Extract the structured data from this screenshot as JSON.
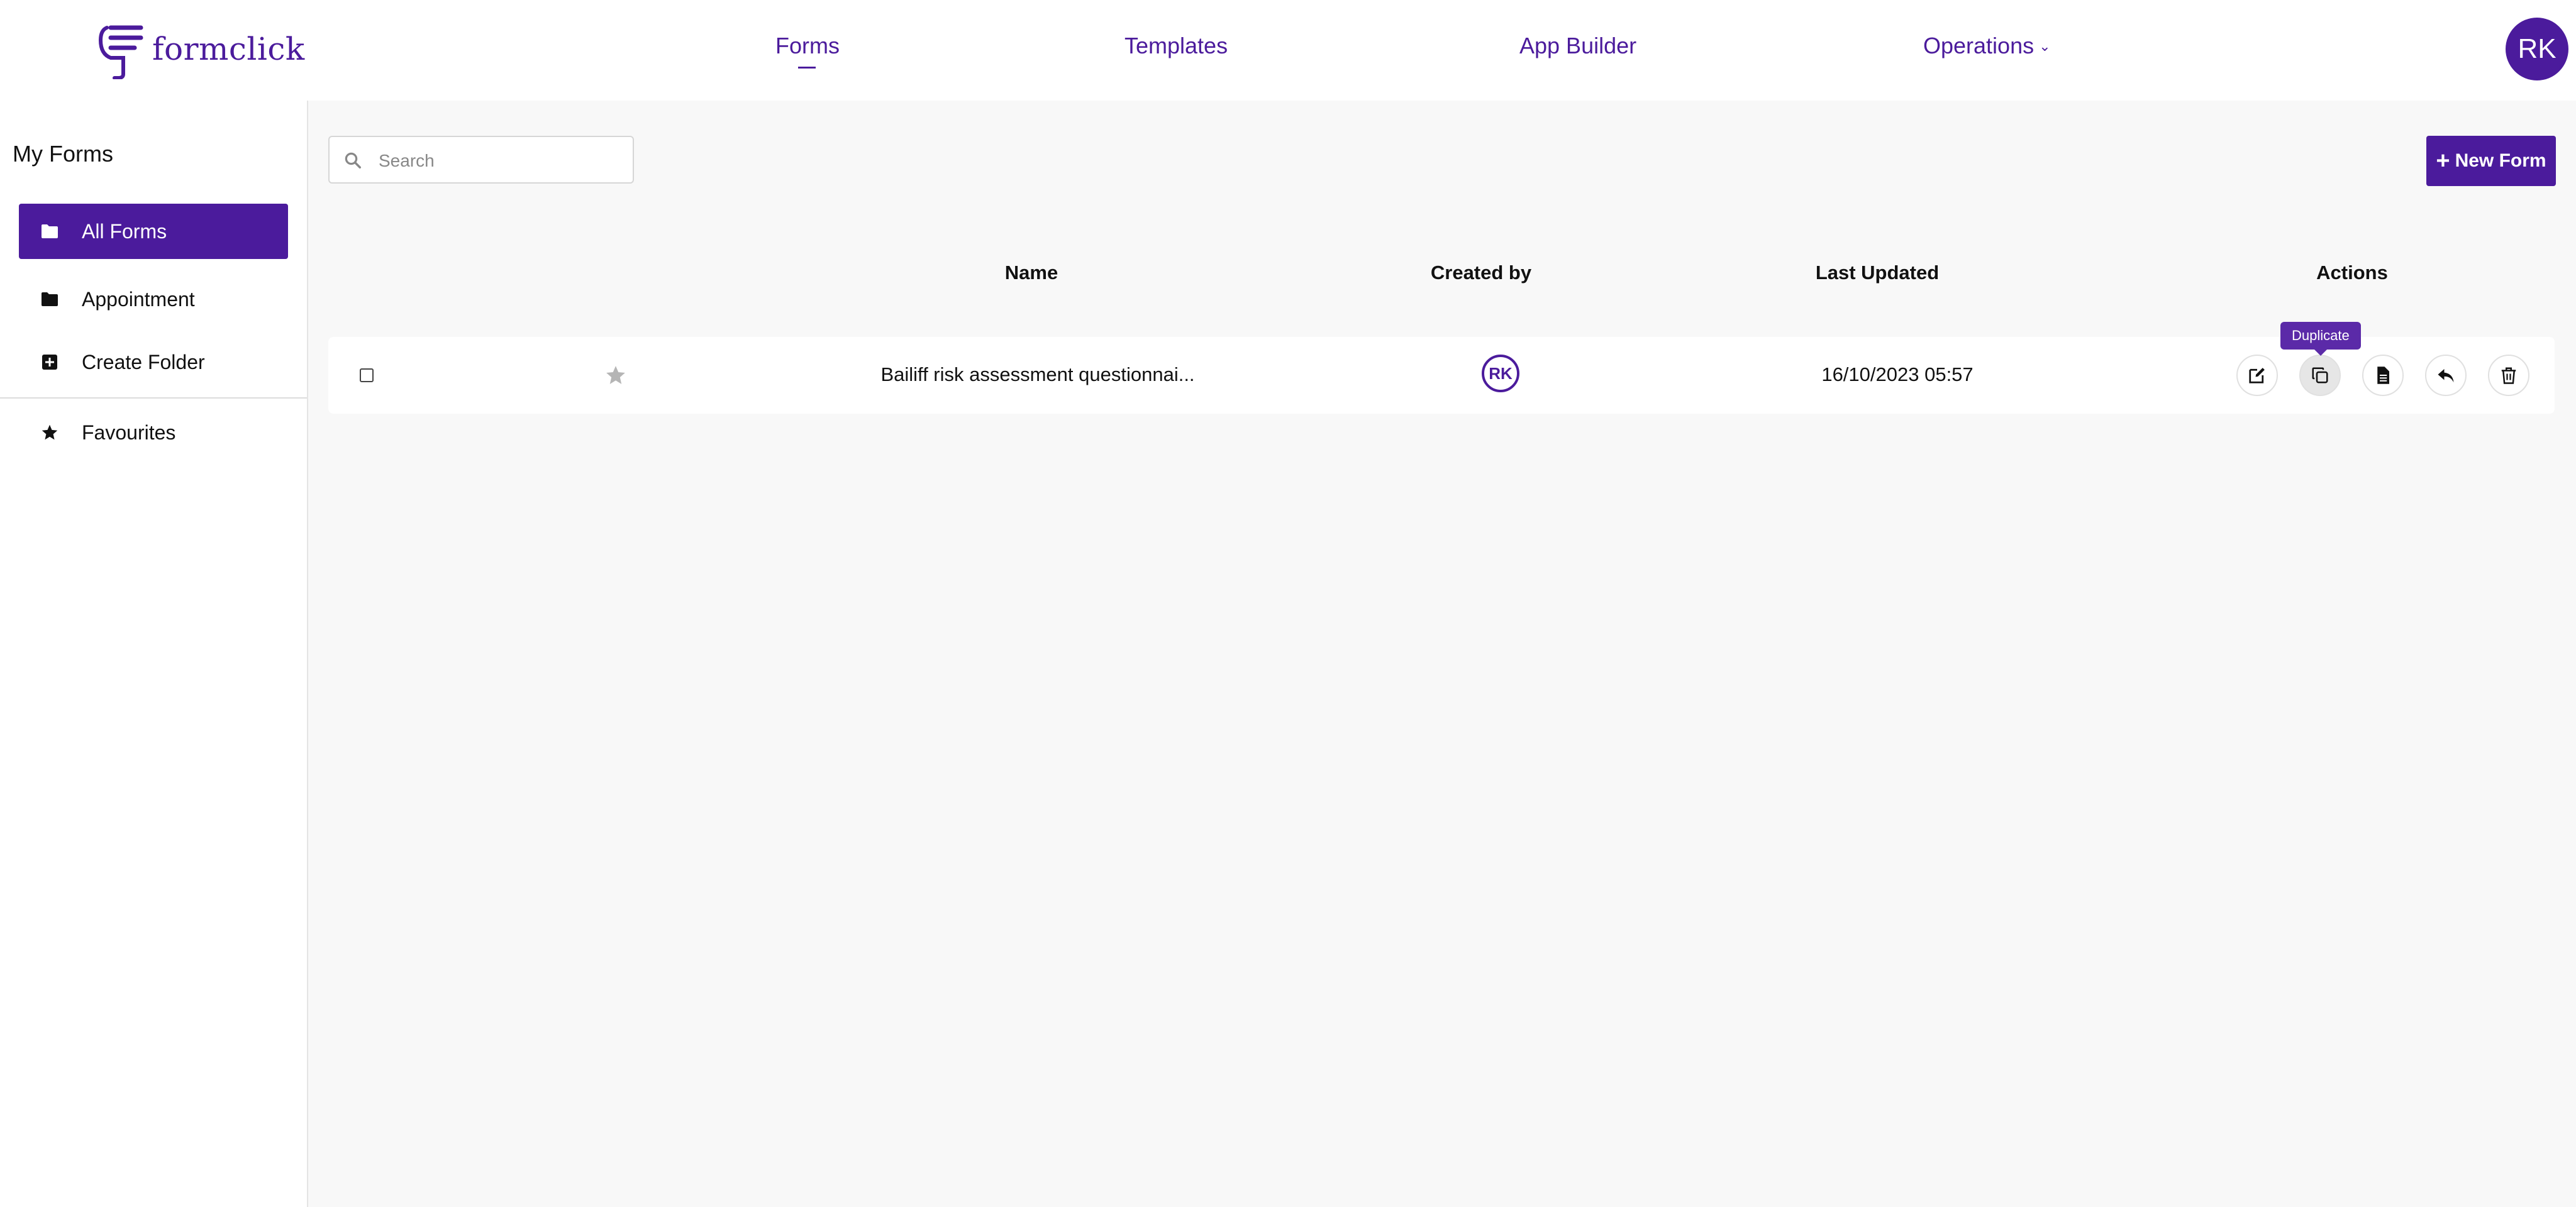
{
  "app": {
    "logo_text": "formclick",
    "user_initials": "RK"
  },
  "nav": {
    "forms": "Forms",
    "templates": "Templates",
    "app_builder": "App Builder",
    "operations": "Operations"
  },
  "sidebar": {
    "title": "My Forms",
    "items": [
      {
        "label": "All Forms",
        "icon": "folder-icon",
        "active": true
      },
      {
        "label": "Appointment",
        "icon": "folder-icon",
        "active": false
      },
      {
        "label": "Create Folder",
        "icon": "plus-square-icon",
        "active": false
      },
      {
        "label": "Favourites",
        "icon": "star-icon",
        "active": false
      }
    ]
  },
  "search": {
    "placeholder": "Search",
    "value": ""
  },
  "toolbar": {
    "new_form_label": "New Form"
  },
  "table": {
    "columns": [
      "Name",
      "Created by",
      "Last Updated",
      "Actions"
    ],
    "rows": [
      {
        "name": "Bailiff risk assessment questionnai...",
        "created_by": "RK",
        "last_updated": "16/10/2023 05:57"
      }
    ]
  },
  "tooltip": {
    "text": "Duplicate"
  },
  "colors": {
    "brand": "#4b1b9c",
    "tooltip": "#5b2aa8",
    "background": "#f8f8f8"
  }
}
